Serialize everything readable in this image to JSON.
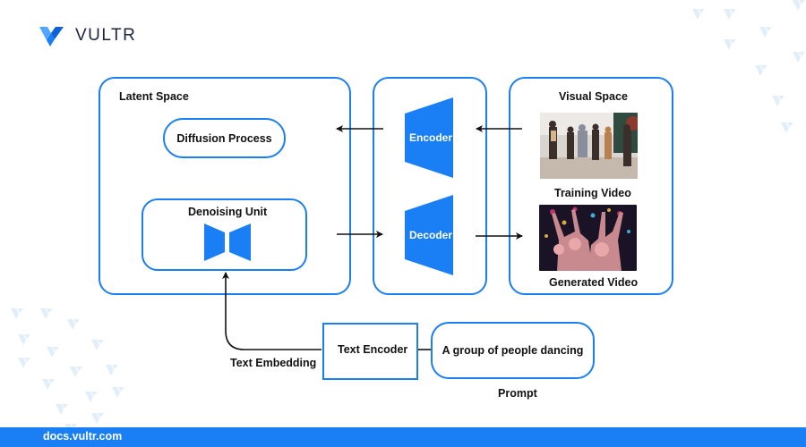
{
  "brand": {
    "name": "VULTR",
    "logo_icon": "vultr-v-logo-icon",
    "accent_color": "#1a7ef5",
    "footer_url": "docs.vultr.com"
  },
  "diagram": {
    "latent_space": {
      "title": "Latent Space",
      "diffusion_process": "Diffusion Process",
      "denoising_unit": "Denoising Unit",
      "denoising_icon": "bowtie-unet-icon"
    },
    "codec": {
      "encoder": "Encoder",
      "decoder": "Decoder"
    },
    "visual_space": {
      "title": "Visual Space",
      "training_video_caption": "Training Video",
      "training_video_image": "people dancing in a living room",
      "generated_video_caption": "Generated Video",
      "generated_video_image": "crowd dancing at a party with colorful lights"
    },
    "text_branch": {
      "text_encoder": "Text Encoder",
      "text_embedding": "Text Embedding",
      "prompt_text": "A group of people dancing",
      "prompt_label": "Prompt"
    }
  }
}
